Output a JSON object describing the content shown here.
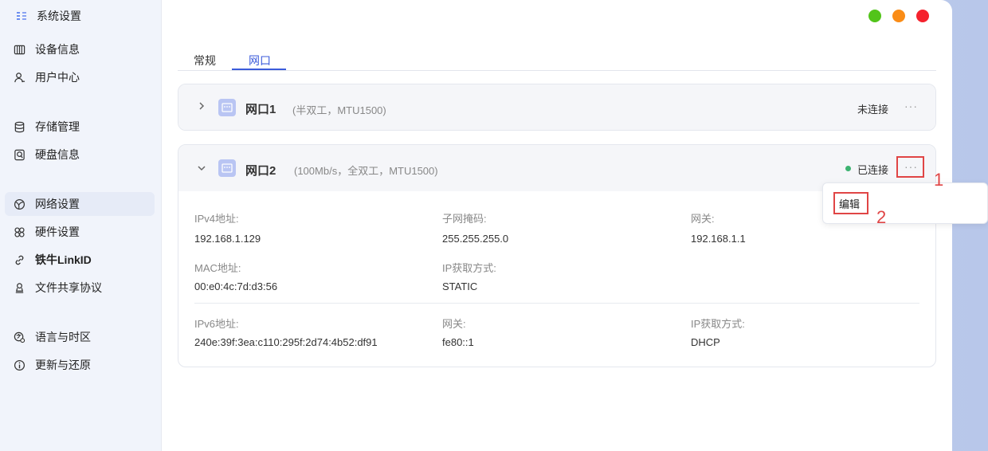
{
  "app": {
    "title": "系统设置",
    "logo_icon": "settings-grid-icon"
  },
  "sidebar": {
    "items": [
      {
        "label": "设备信息",
        "icon": "device-info-icon"
      },
      {
        "label": "用户中心",
        "icon": "user-icon"
      },
      {
        "label": "存储管理",
        "icon": "storage-icon"
      },
      {
        "label": "硬盘信息",
        "icon": "disk-icon"
      },
      {
        "label": "网络设置",
        "icon": "globe-icon",
        "active": true
      },
      {
        "label": "硬件设置",
        "icon": "hardware-icon"
      },
      {
        "label": "铁牛LinkID",
        "icon": "link-icon"
      },
      {
        "label": "文件共享协议",
        "icon": "share-icon"
      },
      {
        "label": "语言与时区",
        "icon": "language-icon"
      },
      {
        "label": "更新与还原",
        "icon": "info-icon"
      }
    ]
  },
  "window_controls": {
    "colors": [
      "#52c41a",
      "#fa8c16",
      "#f5222d"
    ]
  },
  "tabs": [
    {
      "label": "常规",
      "active": false
    },
    {
      "label": "网口",
      "active": true
    }
  ],
  "ports": [
    {
      "name": "网口1",
      "desc": "(半双工，MTU1500)",
      "status": "未连接",
      "more": "···",
      "expanded": false
    },
    {
      "name": "网口2",
      "desc": "(100Mb/s，全双工，MTU1500)",
      "status": "已连接",
      "more": "···",
      "expanded": true,
      "ipv4": {
        "ipv4_label": "IPv4地址:",
        "ipv4_value": "192.168.1.129",
        "mask_label": "子网掩码:",
        "mask_value": "255.255.255.0",
        "gateway_label": "网关:",
        "gateway_value": "192.168.1.1",
        "mac_label": "MAC地址:",
        "mac_value": "00:e0:4c:7d:d3:56",
        "method_label": "IP获取方式:",
        "method_value": "STATIC"
      },
      "ipv6": {
        "ipv6_label": "IPv6地址:",
        "ipv6_value": "240e:39f:3ea:c110:295f:2d74:4b52:df91",
        "gateway_label": "网关:",
        "gateway_value": "fe80::1",
        "method_label": "IP获取方式:",
        "method_value": "DHCP"
      }
    }
  ],
  "context_menu": {
    "edit_label": "编辑"
  },
  "annotations": {
    "step1": "1",
    "step2": "2",
    "color": "#e04545"
  }
}
